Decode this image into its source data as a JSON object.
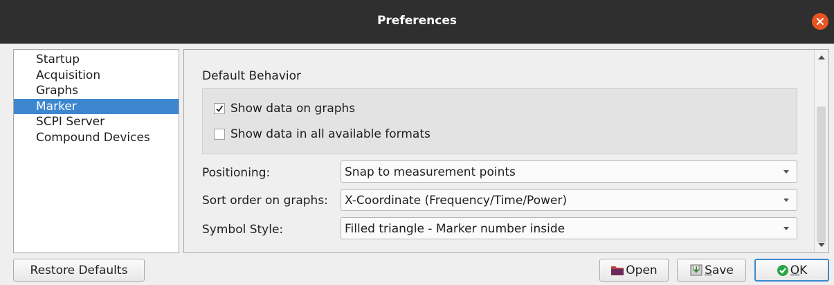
{
  "window": {
    "title": "Preferences"
  },
  "nav": {
    "items": [
      {
        "label": "Startup"
      },
      {
        "label": "Acquisition"
      },
      {
        "label": "Graphs"
      },
      {
        "label": "Marker"
      },
      {
        "label": "SCPI Server"
      },
      {
        "label": "Compound Devices"
      }
    ],
    "selected": "Marker"
  },
  "marker_page": {
    "default_behavior": {
      "heading": "Default Behavior",
      "show_data_on_graphs": {
        "label": "Show data on graphs",
        "checked": true
      },
      "show_all_formats": {
        "label": "Show data in all available formats",
        "checked": false
      }
    },
    "positioning": {
      "label": "Positioning:",
      "value": "Snap to measurement points"
    },
    "sort_order": {
      "label": "Sort order on graphs:",
      "value": "X-Coordinate (Frequency/Time/Power)"
    },
    "symbol_style": {
      "label": "Symbol Style:",
      "value": "Filled triangle - Marker number inside"
    }
  },
  "buttons": {
    "restore_defaults": "Restore Defaults",
    "open": "Open",
    "save_first": "S",
    "save_rest": "ave",
    "ok_first": "O",
    "ok_rest": "K"
  },
  "icons": {
    "close": "close-icon",
    "open": "folder-icon",
    "save": "save-icon",
    "ok": "check-circle-icon"
  },
  "colors": {
    "titlebar": "#2f2f2f",
    "close_button": "#e95420",
    "selection": "#3d87cf",
    "ok_icon": "#2aa546"
  }
}
